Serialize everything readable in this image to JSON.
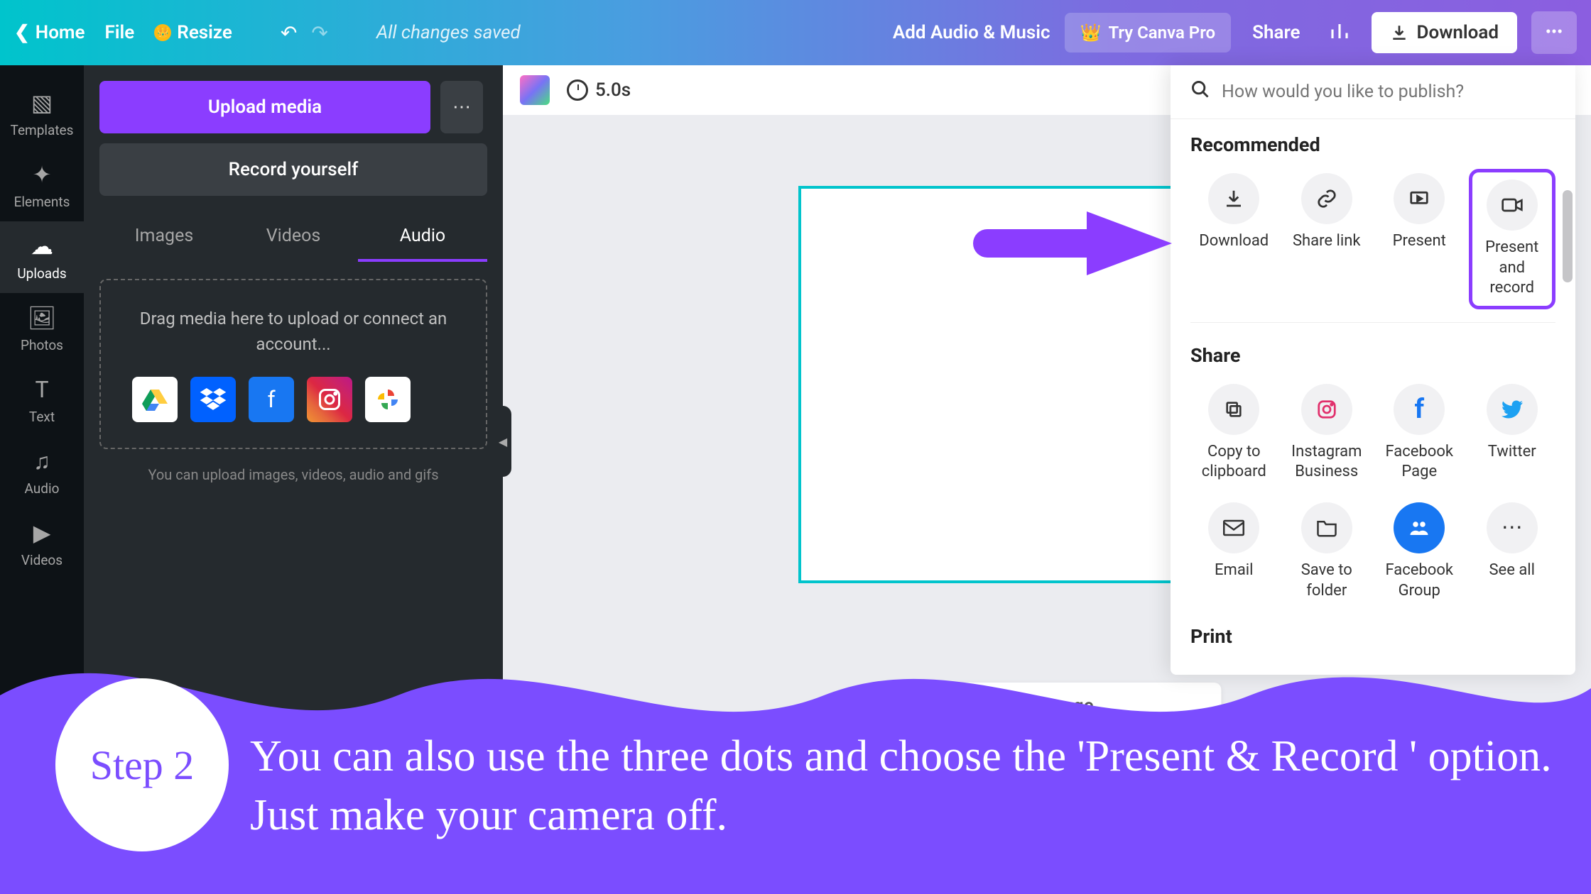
{
  "topbar": {
    "home": "Home",
    "file": "File",
    "resize": "Resize",
    "saved": "All changes saved",
    "audio_music": "Add Audio & Music",
    "try_pro": "Try Canva Pro",
    "share": "Share",
    "download": "Download"
  },
  "rail": {
    "templates": "Templates",
    "elements": "Elements",
    "uploads": "Uploads",
    "photos": "Photos",
    "text": "Text",
    "audio": "Audio",
    "videos": "Videos"
  },
  "sidepanel": {
    "upload_media": "Upload media",
    "record_yourself": "Record yourself",
    "tab_images": "Images",
    "tab_videos": "Videos",
    "tab_audio": "Audio",
    "drop_text": "Drag media here to upload or connect an account...",
    "hint": "You can upload images, videos, audio and gifs"
  },
  "canvas": {
    "duration": "5.0s",
    "add_page": "+ Add page"
  },
  "share_panel": {
    "search_placeholder": "How would you like to publish?",
    "recommended": "Recommended",
    "share_title": "Share",
    "print_title": "Print",
    "download": "Download",
    "share_link": "Share link",
    "present": "Present",
    "present_record": "Present and record",
    "copy_clipboard": "Copy to clipboard",
    "instagram_biz": "Instagram Business",
    "facebook_page": "Facebook Page",
    "twitter": "Twitter",
    "email": "Email",
    "save_folder": "Save to folder",
    "facebook_group": "Facebook Group",
    "see_all": "See all"
  },
  "overlay": {
    "step": "Step 2",
    "text": "You can also use the three dots and choose the 'Present & Record ' option. Just make your camera off."
  }
}
